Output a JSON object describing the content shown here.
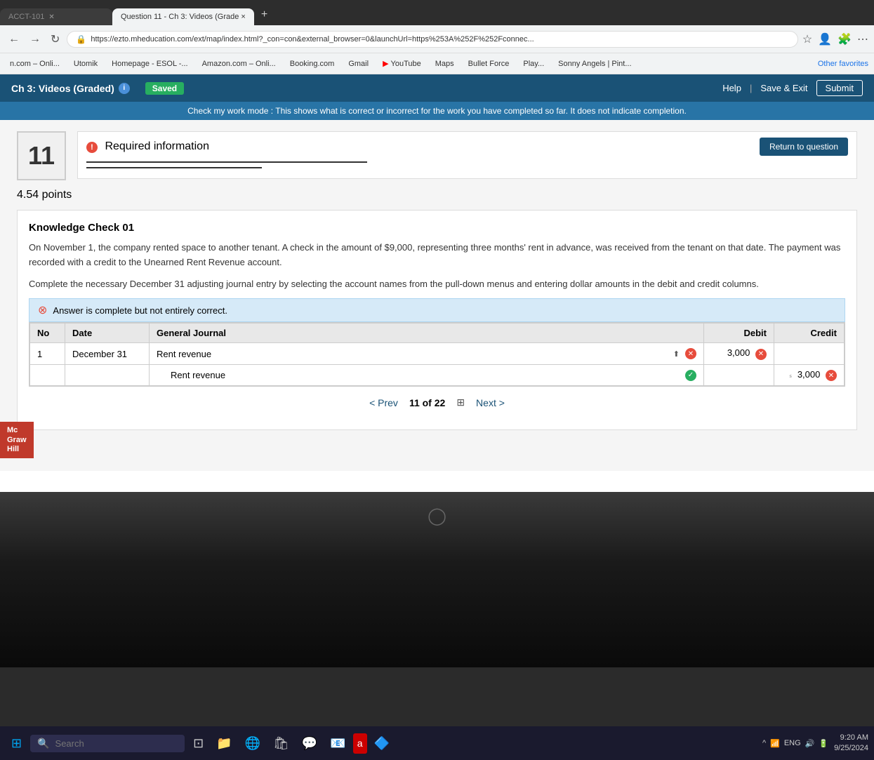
{
  "browser": {
    "tabs": [
      {
        "label": "ACCT-101 ×",
        "active": false
      },
      {
        "label": "Question 11 - Ch 3: Videos (Grade ×",
        "active": true
      },
      {
        "label": "+",
        "active": false
      }
    ],
    "address": "https://ezto.mheducation.com/ext/map/index.html?_con=con&external_browser=0&launchUrl=https%253A%252F%252Fconnec...",
    "bookmarks": [
      {
        "label": "n.com – Onli..."
      },
      {
        "label": "Utomik"
      },
      {
        "label": "Homepage - ESOL -..."
      },
      {
        "label": "Amazon.com – Onli..."
      },
      {
        "label": "Booking.com"
      },
      {
        "label": "Gmail"
      },
      {
        "label": "YouTube"
      },
      {
        "label": "Maps"
      },
      {
        "label": "Bullet Force"
      },
      {
        "label": "Play..."
      },
      {
        "label": "Sonny Angels | Pint..."
      },
      {
        "label": "Other favorites"
      }
    ]
  },
  "page": {
    "title": "Ch 3: Videos (Graded)",
    "saved_label": "Saved",
    "check_mode_text": "Check my work mode : This shows what is correct or incorrect for the work you have completed so far. It does not indicate completion.",
    "help_label": "Help",
    "save_exit_label": "Save & Exit",
    "submit_label": "Submit",
    "return_to_question_label": "Return to question",
    "question_number": "11",
    "points_value": "4.54",
    "points_label": "points",
    "required_info_label": "Required information",
    "kc_title": "Knowledge Check 01",
    "question_text_1": "On November 1, the company rented space to another tenant. A check in the amount of $9,000, representing three months' rent in advance, was received from the tenant on that date. The payment was recorded with a credit to the Unearned Rent Revenue account.",
    "question_text_2": "Complete the necessary December 31 adjusting journal entry by selecting the account names from the pull-down menus and entering dollar amounts in the debit and credit columns.",
    "answer_status": "Answer is complete but not entirely correct.",
    "table": {
      "headers": [
        "No",
        "Date",
        "General Journal",
        "Debit",
        "Credit"
      ],
      "rows": [
        {
          "no": "1",
          "date": "December 31",
          "general_journal": "Rent revenue",
          "debit": "3,000",
          "credit": "",
          "debit_error": true,
          "credit_error": false,
          "gj_error": true,
          "gj_check": false
        },
        {
          "no": "",
          "date": "",
          "general_journal": "Rent revenue",
          "debit": "",
          "credit": "3,000",
          "debit_error": false,
          "credit_error": true,
          "gj_error": false,
          "gj_check": true
        }
      ]
    },
    "pagination": {
      "prev_label": "< Prev",
      "page_info": "11 of 22",
      "next_label": "Next >",
      "grid_icon": "⊞"
    }
  },
  "mcgraw": {
    "line1": "Mc",
    "line2": "Graw",
    "line3": "Hill"
  },
  "taskbar": {
    "search_placeholder": "Search",
    "time": "9:20 AM",
    "date": "9/25/2024",
    "lang": "ENG"
  }
}
